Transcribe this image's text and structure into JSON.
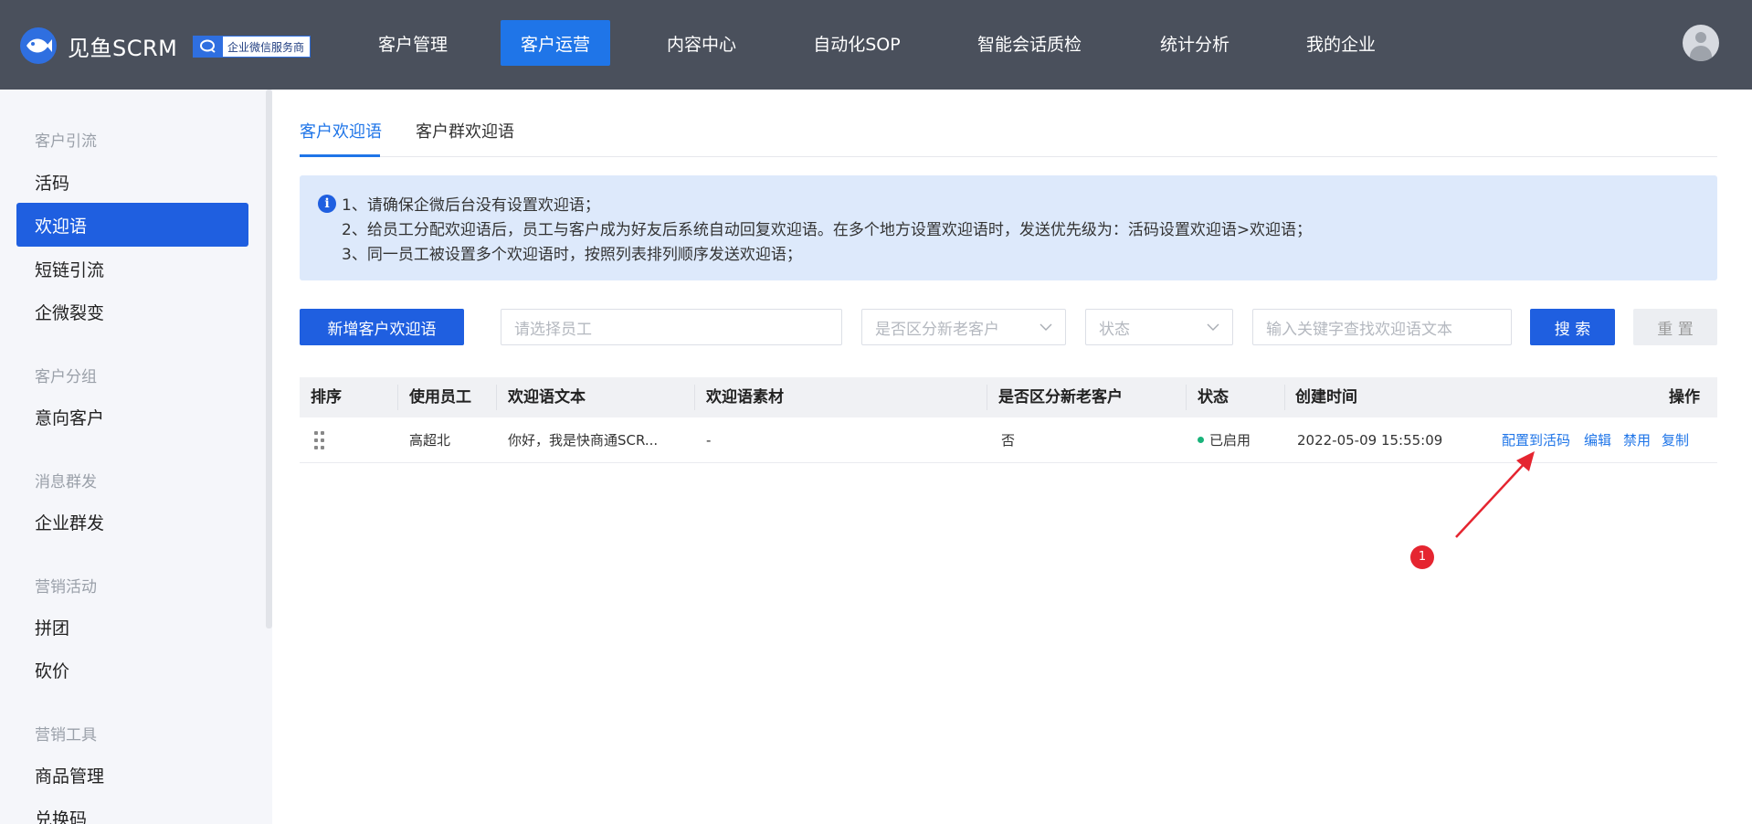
{
  "brand": {
    "name": "见鱼SCRM",
    "badge": "企业微信服务商",
    "primary_color": "#1f5fe0",
    "topbar_color": "#4a505c"
  },
  "nav": {
    "items": [
      {
        "label": "客户管理",
        "active": false
      },
      {
        "label": "客户运营",
        "active": true
      },
      {
        "label": "内容中心",
        "active": false
      },
      {
        "label": "自动化SOP",
        "active": false
      },
      {
        "label": "智能会话质检",
        "active": false
      },
      {
        "label": "统计分析",
        "active": false
      },
      {
        "label": "我的企业",
        "active": false
      }
    ],
    "avatar_icon": "user-avatar-icon"
  },
  "sidebar": {
    "groups": [
      {
        "title": "客户引流",
        "items": [
          "活码",
          "欢迎语",
          "短链引流",
          "企微裂变"
        ]
      },
      {
        "title": "客户分组",
        "items": [
          "意向客户"
        ]
      },
      {
        "title": "消息群发",
        "items": [
          "企业群发"
        ]
      },
      {
        "title": "营销活动",
        "items": [
          "拼团",
          "砍价"
        ]
      },
      {
        "title": "营销工具",
        "items": [
          "商品管理",
          "兑换码"
        ]
      }
    ],
    "active_item": "欢迎语"
  },
  "tabs": [
    {
      "label": "客户欢迎语",
      "active": true
    },
    {
      "label": "客户群欢迎语",
      "active": false
    }
  ],
  "notice": {
    "icon": "info-icon",
    "lines": [
      "1、请确保企微后台没有设置欢迎语；",
      "2、给员工分配欢迎语后，员工与客户成为好友后系统自动回复欢迎语。在多个地方设置欢迎语时，发送优先级为：活码设置欢迎语>欢迎语；",
      "3、同一员工被设置多个欢迎语时，按照列表排列顺序发送欢迎语；"
    ]
  },
  "toolbar": {
    "add_button": "新增客户欢迎语",
    "employee_placeholder": "请选择员工",
    "distinguish_placeholder": "是否区分新老客户",
    "status_placeholder": "状态",
    "keyword_placeholder": "输入关键字查找欢迎语文本",
    "search_button": "搜 索",
    "reset_button": "重 置"
  },
  "table": {
    "columns": [
      "排序",
      "使用员工",
      "欢迎语文本",
      "欢迎语素材",
      "是否区分新老客户",
      "状态",
      "创建时间",
      "操作"
    ],
    "rows": [
      {
        "employee": "高超北",
        "text": "你好，我是快商通SCR...",
        "material": "-",
        "distinguish": "否",
        "status": "已启用",
        "status_color": "#19b37a",
        "created": "2022-05-09 15:55:09",
        "actions": [
          "配置到活码",
          "编辑",
          "禁用",
          "复制"
        ]
      }
    ]
  },
  "annotation": {
    "marker_label": "1",
    "color": "#e52530"
  }
}
